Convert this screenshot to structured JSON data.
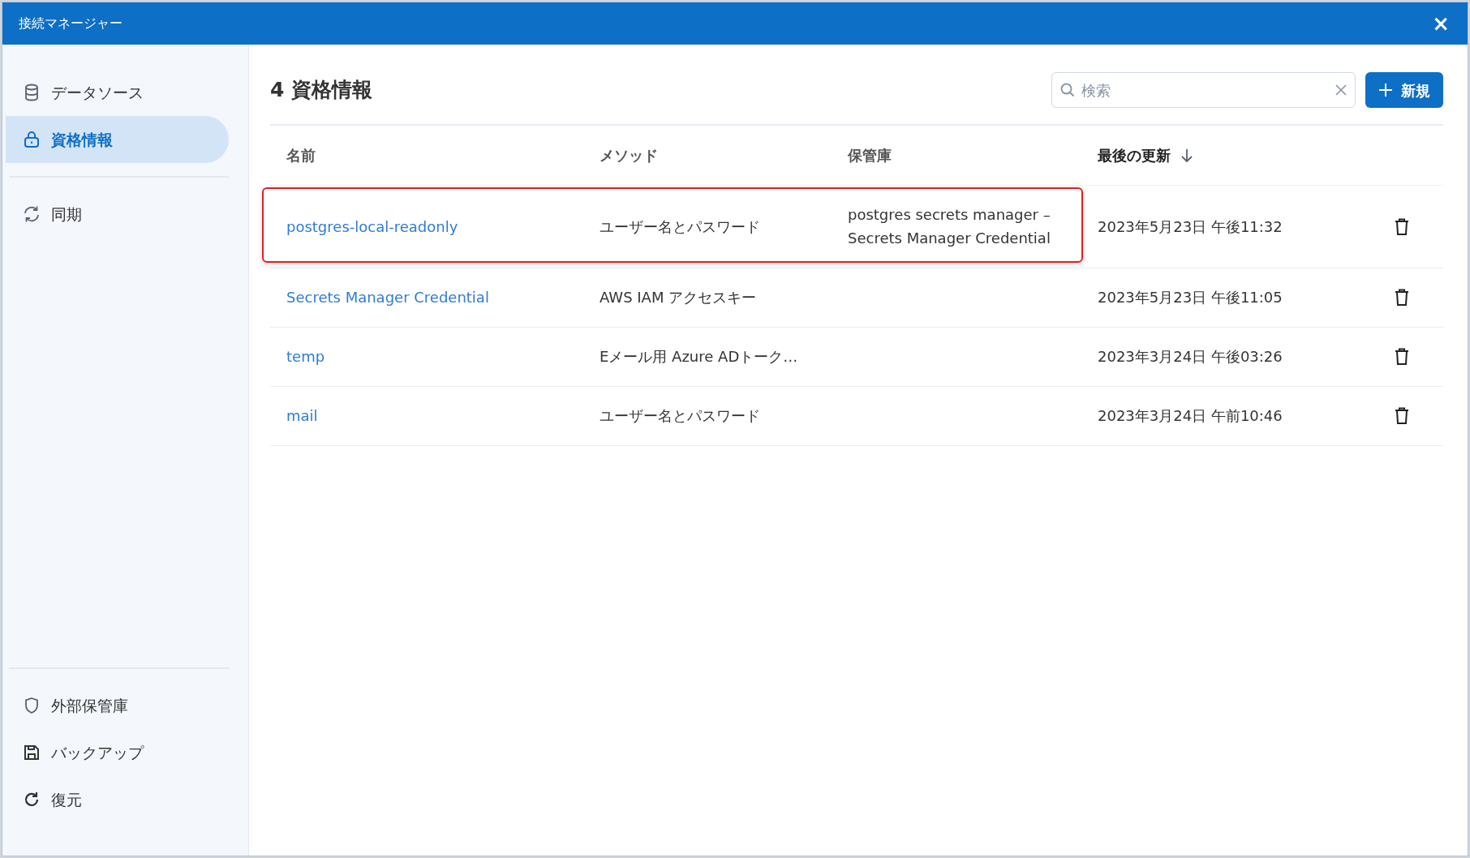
{
  "window": {
    "title": "接続マネージャー",
    "close": "×"
  },
  "sidebar": {
    "top_items": [
      {
        "label": "データソース",
        "selected": false
      },
      {
        "label": "資格情報",
        "selected": true
      }
    ],
    "middle_items": [
      {
        "label": "同期",
        "selected": false
      }
    ],
    "bottom_items": [
      {
        "label": "外部保管庫",
        "selected": false
      },
      {
        "label": "バックアップ",
        "selected": false
      },
      {
        "label": "復元",
        "selected": false
      }
    ]
  },
  "header": {
    "title": "4 資格情報",
    "search": {
      "placeholder": "検索"
    },
    "new_button": "新規"
  },
  "table": {
    "columns": [
      {
        "label": "名前",
        "sorted": false
      },
      {
        "label": "メソッド",
        "sorted": false
      },
      {
        "label": "保管庫",
        "sorted": false
      },
      {
        "label": "最後の更新",
        "sorted": true
      }
    ],
    "rows": [
      {
        "name": "postgres-local-readonly",
        "method": "ユーザー名とパスワード",
        "vault": "postgres secrets manager – Secrets Manager Credential",
        "updated": "2023年5月23日 午後11:32",
        "highlighted": true
      },
      {
        "name": "Secrets Manager Credential",
        "method": "AWS IAM アクセスキー",
        "updated": "2023年5月23日 午後11:05",
        "highlighted": false
      },
      {
        "name": "temp",
        "method": "Eメール用 Azure ADトーク…",
        "updated": "2023年3月24日 午後03:26",
        "highlighted": false
      },
      {
        "name": "mail",
        "method": "ユーザー名とパスワード",
        "updated": "2023年3月24日 午前10:46",
        "highlighted": false
      }
    ]
  }
}
